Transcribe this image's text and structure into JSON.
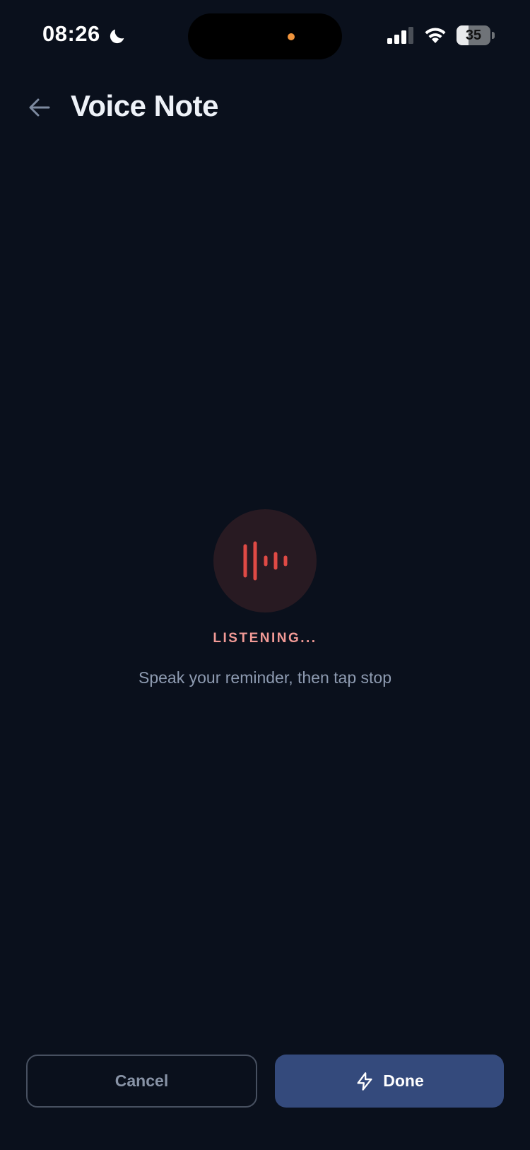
{
  "status_bar": {
    "time": "08:26",
    "battery_percent": "35",
    "battery_level": 0.35,
    "icons": [
      "moon-icon",
      "signal-icon",
      "wifi-icon",
      "battery-icon"
    ]
  },
  "header": {
    "title": "Voice Note",
    "back_icon": "arrow-left-icon"
  },
  "recording": {
    "icon": "waveform-icon",
    "status": "LISTENING...",
    "hint": "Speak your reminder, then tap stop"
  },
  "actions": {
    "cancel_label": "Cancel",
    "done_label": "Done",
    "done_icon": "bolt-icon"
  },
  "colors": {
    "background": "#0a101c",
    "accent_red": "#e04a45",
    "status_text": "#f29a96",
    "primary_button": "#344a7c",
    "island_indicator": "#f0943c"
  }
}
